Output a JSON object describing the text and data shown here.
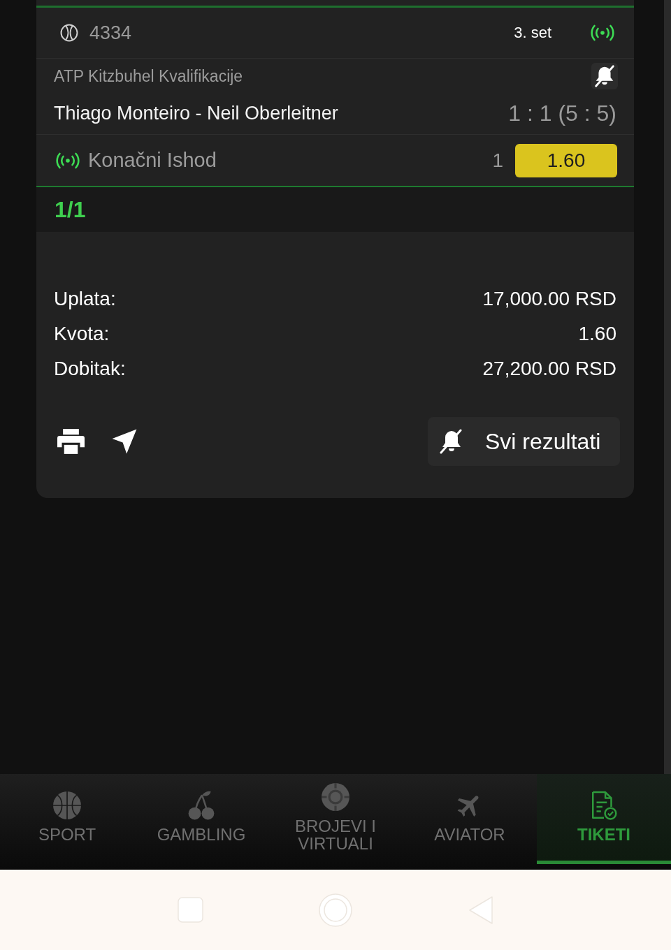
{
  "ticket": {
    "event_id": "4334",
    "period": "3. set",
    "live": true
  },
  "event": {
    "league": "ATP Kitzbuhel Kvalifikacije",
    "notifications": false,
    "match": "Thiago Monteiro - Neil Oberleitner",
    "score": "1 : 1 (5 : 5)"
  },
  "market": {
    "name": "Konačni Ishod",
    "live": true,
    "pick": "1",
    "odds": "1.60"
  },
  "ticket_count": "1/1",
  "summary": [
    {
      "label": "Uplata:",
      "value": "17,000.00 RSD"
    },
    {
      "label": "Kvota:",
      "value": "1.60"
    },
    {
      "label": "Dobitak:",
      "value": "27,200.00 RSD"
    }
  ],
  "actions": {
    "results_button": "Svi rezultati"
  },
  "bottom_nav": [
    {
      "label": "SPORT",
      "selected": false
    },
    {
      "label": "GAMBLING",
      "selected": false
    },
    {
      "label": "BROJEVI I VIRTUALI",
      "selected": false
    },
    {
      "label": "AVIATOR",
      "selected": false
    },
    {
      "label": "TIKETI",
      "selected": true
    }
  ]
}
